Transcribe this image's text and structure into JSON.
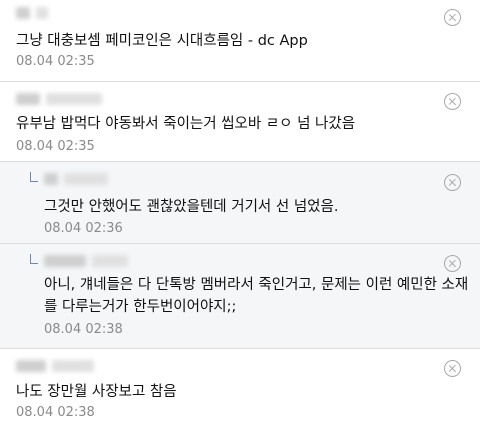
{
  "comments": [
    {
      "type": "comment",
      "text": "그냥 대충보셈 페미코인은 시대흐름임 - dc App",
      "date": "08.04 02:35"
    },
    {
      "type": "comment",
      "text": "유부남 밥먹다 야동봐서 죽이는거 씹오바 ㄹㅇ 넘 나갔음",
      "date": "08.04 02:35"
    },
    {
      "type": "reply",
      "text": "그것만 안했어도 괜찮았을텐데 거기서 선 넘었음.",
      "date": "08.04 02:36"
    },
    {
      "type": "reply",
      "text_lines": [
        "아니, 걔네들은 다 단톡방 멤버라서 죽인거고, 문제는 이런 예민한 소재",
        "를 다루는거가 한두번이어야지;;"
      ],
      "date": "08.04 02:38"
    },
    {
      "type": "comment",
      "text": "나도 장만월 사장보고 참음",
      "date": "08.04 02:38"
    }
  ],
  "icons": {
    "delete": "close-circle-icon",
    "reply": "reply-arrow-icon"
  },
  "colors": {
    "reply_bg": "#f4f6f8",
    "date": "#8a8a8a",
    "divider": "#dcdcdc",
    "reply_mark": "#6a8ab5"
  }
}
